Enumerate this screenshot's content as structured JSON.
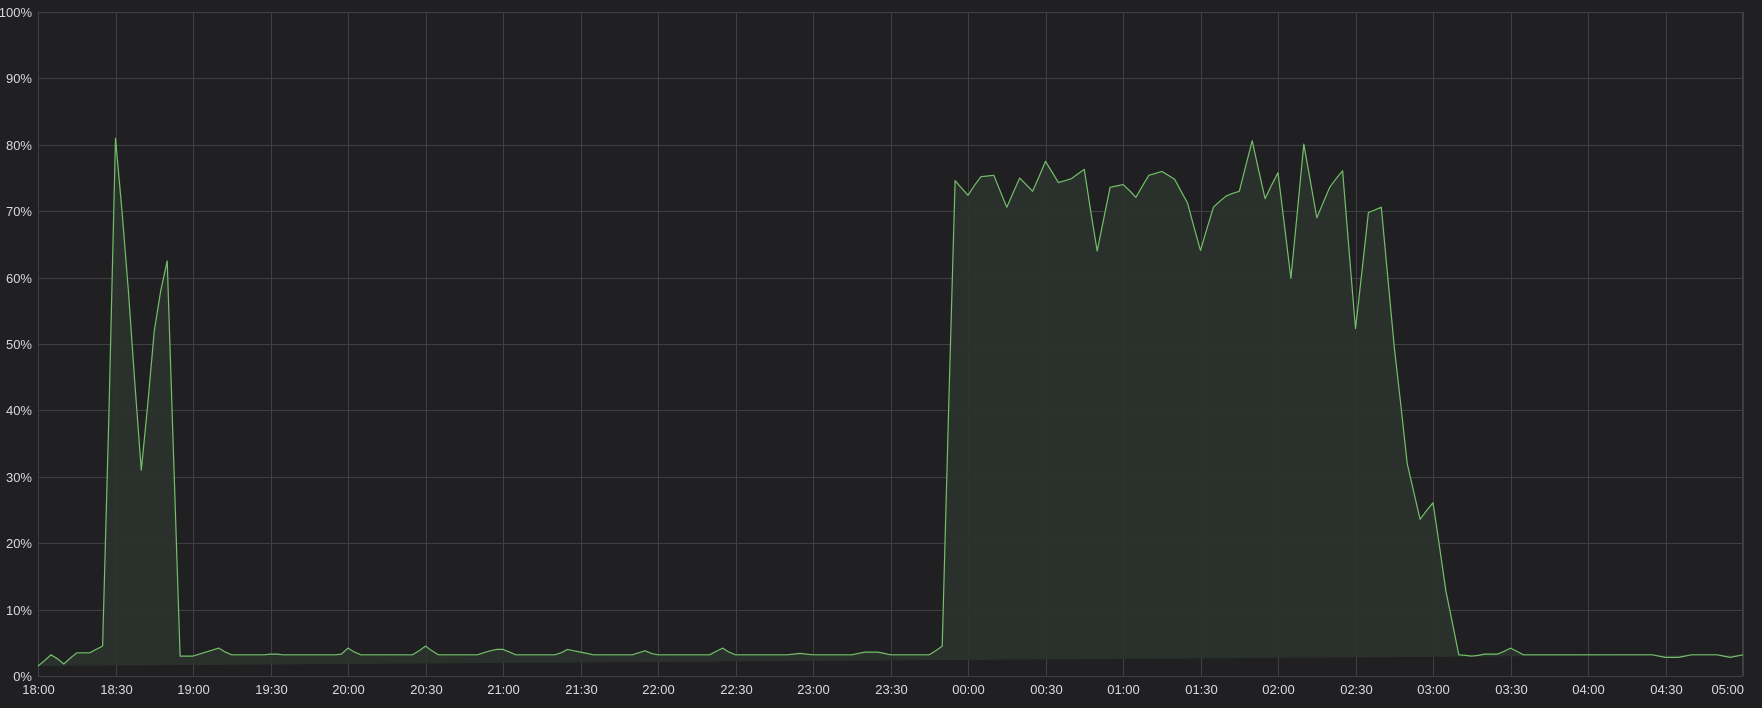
{
  "chart_data": {
    "type": "area",
    "title": "",
    "xlabel": "",
    "ylabel": "",
    "unit": "%",
    "ylim": [
      0,
      100
    ],
    "xlim": [
      "18:00",
      "05:00"
    ],
    "grid": true,
    "legend": "none",
    "y_ticks": [
      "0%",
      "10%",
      "20%",
      "30%",
      "40%",
      "50%",
      "60%",
      "70%",
      "80%",
      "90%",
      "100%"
    ],
    "y_tick_values": [
      0,
      10,
      20,
      30,
      40,
      50,
      60,
      70,
      80,
      90,
      100
    ],
    "x_ticks": [
      "18:00",
      "18:30",
      "19:00",
      "19:30",
      "20:00",
      "20:30",
      "21:00",
      "21:30",
      "22:00",
      "22:30",
      "23:00",
      "23:30",
      "00:00",
      "00:30",
      "01:00",
      "01:30",
      "02:00",
      "02:30",
      "03:00",
      "03:30",
      "04:00",
      "04:30",
      "05:00"
    ],
    "colors": {
      "line": "#73bf69",
      "fill": "#2b332d",
      "background": "#202022",
      "grid": "#404044",
      "text": "#d8d9da"
    },
    "series": [
      {
        "x_minutes_from_18_00": [
          0,
          2.5,
          5,
          7.5,
          10,
          12.5,
          15,
          17.5,
          20,
          22.5,
          25,
          27.5,
          30,
          32.5,
          35,
          37.5,
          40,
          42.5,
          45,
          47.5,
          50,
          52.5,
          55,
          57.5,
          60,
          62.5,
          65,
          67.5,
          70,
          72.5,
          75,
          77.5,
          80,
          82.5,
          85,
          87.5,
          90,
          92.5,
          95,
          97.5,
          100,
          102.5,
          105,
          107.5,
          110,
          112.5,
          115,
          117.5,
          120,
          122.5,
          125,
          127.5,
          130,
          132.5,
          135,
          137.5,
          140,
          142.5,
          145,
          147.5,
          150,
          152.5,
          155,
          157.5,
          160,
          162.5,
          165,
          167.5,
          170,
          172.5,
          175,
          177.5,
          180,
          182.5,
          185,
          187.5,
          190,
          192.5,
          195,
          197.5,
          200,
          202.5,
          205,
          207.5,
          210,
          212.5,
          215,
          217.5,
          220,
          222.5,
          225,
          227.5,
          230,
          232.5,
          235,
          237.5,
          240,
          242.5,
          245,
          247.5,
          250,
          252.5,
          255,
          257.5,
          260,
          262.5,
          265,
          267.5,
          270,
          272.5,
          275,
          277.5,
          280,
          282.5,
          285,
          287.5,
          290,
          292.5,
          295,
          297.5,
          300,
          302.5,
          305,
          307.5,
          310,
          312.5,
          315,
          317.5,
          320,
          322.5,
          325,
          327.5,
          330,
          332.5,
          335,
          337.5,
          340,
          342.5,
          345,
          347.5,
          350,
          352.5,
          355,
          357.5,
          360,
          362.5,
          365,
          367.5,
          370,
          372.5,
          375,
          377.5,
          380,
          382.5,
          385,
          387.5,
          390,
          392.5,
          395,
          397.5,
          400,
          402.5,
          405,
          407.5,
          410,
          412.5,
          415,
          417.5,
          420,
          422.5,
          425,
          427.5,
          430,
          432.5,
          435,
          437.5,
          440,
          442.5,
          445,
          447.5,
          450,
          452.5,
          455,
          457.5,
          460,
          462.5,
          465,
          467.5,
          470,
          472.5,
          475,
          477.5,
          480,
          482.5,
          485,
          487.5,
          490,
          492.5,
          495,
          497.5,
          500,
          502.5,
          505,
          507.5,
          510,
          512.5,
          515,
          517.5,
          520,
          522.5,
          525,
          527.5,
          530,
          532.5,
          535,
          537.5,
          540,
          542.5,
          545,
          547.5,
          550,
          552.5,
          555,
          557.5,
          560,
          562.5,
          565,
          567.5,
          570,
          572.5,
          575,
          577.5,
          580,
          582.5,
          585,
          587.5,
          590,
          592.5,
          595,
          597.5,
          600,
          602.5,
          605,
          607.5,
          610,
          612.5,
          615,
          617.5,
          620,
          622.5,
          625,
          627.5,
          630,
          632.5,
          635,
          637.5,
          640,
          642.5,
          645,
          647.5,
          650,
          652.5,
          655,
          657.5,
          660
        ],
        "values": [
          1.5,
          2.3,
          3.2,
          2.6,
          1.8,
          2.7,
          3.5,
          3.5,
          3.5,
          4.0,
          4.5,
          40.0,
          81.0,
          70.0,
          58.0,
          44.0,
          31.0,
          41.0,
          52.0,
          58.0,
          62.5,
          33.0,
          3.0,
          3.0,
          3.0,
          3.3,
          3.6,
          3.9,
          4.2,
          3.6,
          3.2,
          3.2,
          3.2,
          3.2,
          3.2,
          3.2,
          3.3,
          3.3,
          3.2,
          3.2,
          3.2,
          3.2,
          3.2,
          3.2,
          3.2,
          3.2,
          3.2,
          3.3,
          4.2,
          3.6,
          3.2,
          3.2,
          3.2,
          3.2,
          3.2,
          3.2,
          3.2,
          3.2,
          3.2,
          3.8,
          4.5,
          3.8,
          3.2,
          3.2,
          3.2,
          3.2,
          3.2,
          3.2,
          3.2,
          3.5,
          3.8,
          4.0,
          4.0,
          3.6,
          3.2,
          3.2,
          3.2,
          3.2,
          3.2,
          3.2,
          3.2,
          3.5,
          4.0,
          3.8,
          3.6,
          3.4,
          3.2,
          3.2,
          3.2,
          3.2,
          3.2,
          3.2,
          3.2,
          3.5,
          3.8,
          3.4,
          3.2,
          3.2,
          3.2,
          3.2,
          3.2,
          3.2,
          3.2,
          3.2,
          3.2,
          3.7,
          4.2,
          3.6,
          3.2,
          3.2,
          3.2,
          3.2,
          3.2,
          3.2,
          3.2,
          3.2,
          3.2,
          3.3,
          3.4,
          3.3,
          3.2,
          3.2,
          3.2,
          3.2,
          3.2,
          3.2,
          3.2,
          3.4,
          3.6,
          3.6,
          3.6,
          3.4,
          3.2,
          3.2,
          3.2,
          3.2,
          3.2,
          3.2,
          3.2,
          3.8,
          4.5,
          40.0,
          74.6,
          73.5,
          72.4,
          73.9,
          75.2,
          75.3,
          75.4,
          73.0,
          70.6,
          72.8,
          75.0,
          74.0,
          73.0,
          75.2,
          77.5,
          75.9,
          74.3,
          74.6,
          74.9,
          75.6,
          76.3,
          70.0,
          64.0,
          68.8,
          73.6,
          73.8,
          74.0,
          73.1,
          72.1,
          73.8,
          75.4,
          75.7,
          76.0,
          75.4,
          74.8,
          73.0,
          71.2,
          67.6,
          64.1,
          67.4,
          70.6,
          71.5,
          72.3,
          72.7,
          73.0,
          76.8,
          80.6,
          76.2,
          71.9,
          73.9,
          75.8,
          67.8,
          59.9,
          70.0,
          80.1,
          74.6,
          69.0,
          71.3,
          73.6,
          74.9,
          76.1,
          64.2,
          52.3,
          61.0,
          69.8,
          70.2,
          70.6,
          60.0,
          49.5,
          41.0,
          32.0,
          27.8,
          23.6,
          24.9,
          26.1,
          19.5,
          12.8,
          8.0,
          3.2,
          3.1,
          3.0,
          3.1,
          3.3,
          3.3,
          3.3,
          3.7,
          4.2,
          3.7,
          3.2,
          3.2,
          3.2,
          3.2,
          3.2,
          3.2,
          3.2,
          3.2,
          3.2,
          3.2,
          3.2,
          3.2,
          3.2,
          3.2,
          3.2,
          3.2,
          3.2,
          3.2,
          3.2,
          3.2,
          3.2,
          3.0,
          2.8,
          2.8,
          2.8,
          3.0,
          3.2,
          3.2,
          3.2,
          3.2,
          3.2,
          3.0,
          2.8,
          3.0,
          3.2,
          3.2,
          3.2,
          1.8,
          0.5,
          0.2,
          0.0,
          0.0,
          0.0,
          0.0,
          0.0,
          0.0,
          0.0,
          0.0,
          0.0,
          0.0
        ]
      }
    ]
  }
}
